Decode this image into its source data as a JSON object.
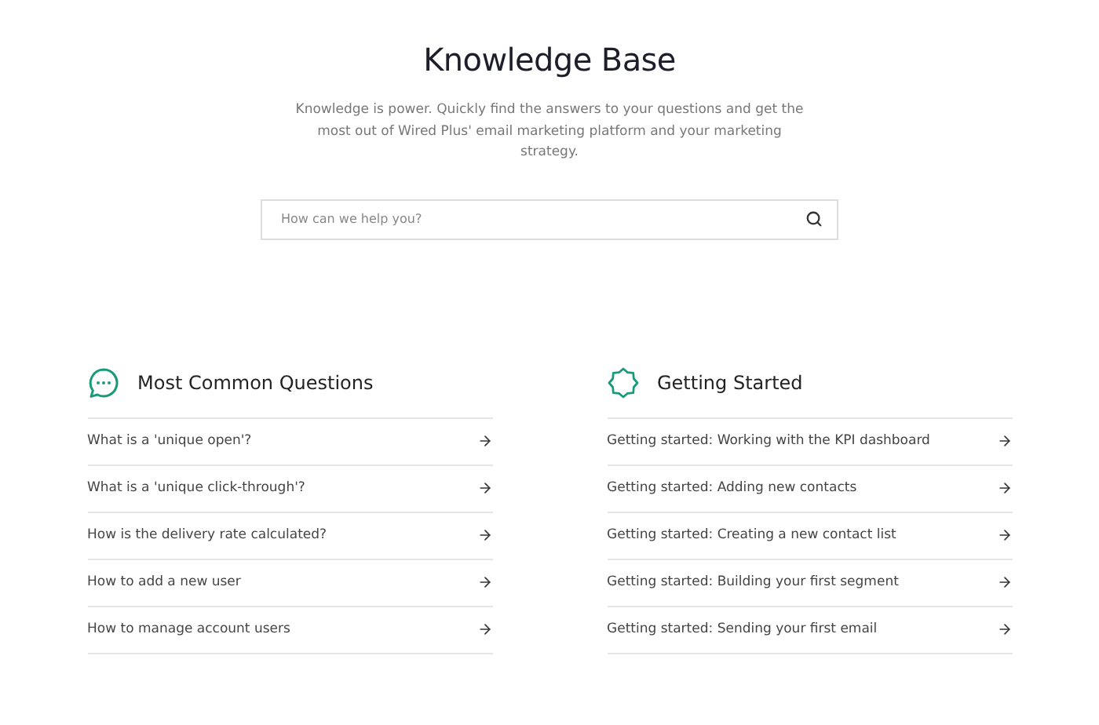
{
  "header": {
    "title": "Knowledge Base",
    "subtitle": "Knowledge is power. Quickly find the answers to your questions and get the most out of Wired Plus' email marketing platform and your marketing strategy."
  },
  "search": {
    "placeholder": "How can we help you?"
  },
  "sections": [
    {
      "kind": "chat",
      "title": "Most Common Questions",
      "items": [
        "What is a 'unique open'?",
        "What is a 'unique click-through'?",
        "How is the delivery rate calculated?",
        "How to add a new user",
        "How to manage account users"
      ]
    },
    {
      "kind": "badge",
      "title": "Getting Started",
      "items": [
        "Getting started: Working with the KPI dashboard",
        "Getting started: Adding new contacts",
        "Getting started: Creating a new contact list",
        "Getting started: Building your first segment",
        "Getting started: Sending your first email"
      ]
    }
  ]
}
